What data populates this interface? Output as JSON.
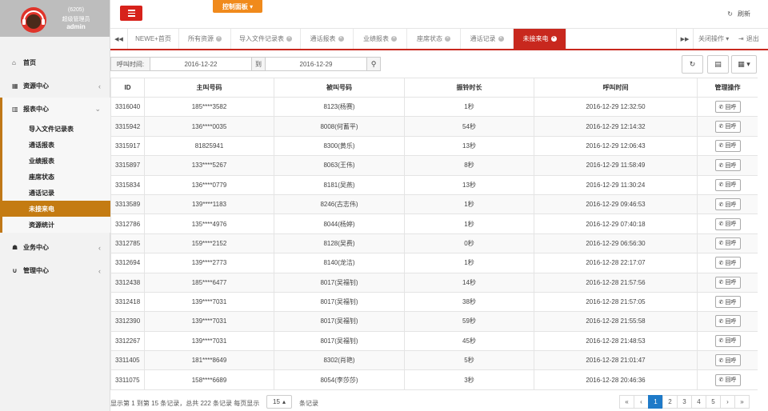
{
  "user": {
    "id": "(6205)",
    "role": "超级管理员",
    "name": "admin"
  },
  "sidebar": {
    "items": [
      {
        "label": "首页",
        "icon": "home-icon",
        "glyph": "⌂"
      },
      {
        "label": "资源中心",
        "icon": "table-icon",
        "glyph": "▦",
        "chev": "‹"
      },
      {
        "label": "报表中心",
        "icon": "bar-chart-icon",
        "glyph": "▥",
        "chev": "⌄"
      },
      {
        "label": "业务中心",
        "icon": "graduation-cap-icon",
        "glyph": "☗",
        "chev": "‹"
      },
      {
        "label": "管理中心",
        "icon": "magnet-icon",
        "glyph": "∪",
        "chev": "‹"
      }
    ],
    "sub": [
      "导入文件记录表",
      "通话报表",
      "业绩报表",
      "座席状态",
      "通话记录",
      "未接来电",
      "资源统计"
    ]
  },
  "topbar": {
    "control_panel": "控制面板 ▾",
    "refresh": "刷新",
    "refresh_icon": "↻"
  },
  "tabs": {
    "items": [
      "NEWE+首页",
      "所有资源",
      "导入文件记录表",
      "通话报表",
      "业绩报表",
      "座席状态",
      "通话记录",
      "未接来电"
    ],
    "close_actions": "关闭操作 ▾",
    "exit": "退出",
    "prev": "◀◀",
    "next": "▶▶",
    "exit_icon": "⇥"
  },
  "filter": {
    "label": "呼叫时间:",
    "start": "2016-12-22",
    "to": "到",
    "end": "2016-12-29",
    "search_icon": "⚲",
    "tools": [
      "↻",
      "▤",
      "▦ ▾"
    ]
  },
  "table": {
    "headers": [
      "ID",
      "主叫号码",
      "被叫号码",
      "振铃时长",
      "呼叫时间",
      "管理操作"
    ],
    "action_label": "回呼",
    "action_icon": "✆",
    "rows": [
      [
        "3316040",
        "185****3582",
        "8123(杨赛)",
        "1秒",
        "2016-12-29 12:32:50"
      ],
      [
        "3315942",
        "136****0035",
        "8008(何蓄平)",
        "54秒",
        "2016-12-29 12:14:32"
      ],
      [
        "3315917",
        "81825941",
        "8300(黄乐)",
        "13秒",
        "2016-12-29 12:06:43"
      ],
      [
        "3315897",
        "133****5267",
        "8063(王伟)",
        "8秒",
        "2016-12-29 11:58:49"
      ],
      [
        "3315834",
        "136****0779",
        "8181(吴燕)",
        "13秒",
        "2016-12-29 11:30:24"
      ],
      [
        "3313589",
        "139****1183",
        "8246(古志伟)",
        "1秒",
        "2016-12-29 09:46:53"
      ],
      [
        "3312786",
        "135****4976",
        "8044(杨婷)",
        "1秒",
        "2016-12-29 07:40:18"
      ],
      [
        "3312785",
        "159****2152",
        "8128(吴费)",
        "0秒",
        "2016-12-29 06:56:30"
      ],
      [
        "3312694",
        "139****2773",
        "8140(龙洁)",
        "1秒",
        "2016-12-28 22:17:07"
      ],
      [
        "3312438",
        "185****6477",
        "8017(吴福钊)",
        "14秒",
        "2016-12-28 21:57:56"
      ],
      [
        "3312418",
        "139****7031",
        "8017(吴福钊)",
        "38秒",
        "2016-12-28 21:57:05"
      ],
      [
        "3312390",
        "139****7031",
        "8017(吴福钊)",
        "59秒",
        "2016-12-28 21:55:58"
      ],
      [
        "3312267",
        "139****7031",
        "8017(吴福钊)",
        "45秒",
        "2016-12-28 21:48:53"
      ],
      [
        "3311405",
        "181****8649",
        "8302(肖艳)",
        "5秒",
        "2016-12-28 21:01:47"
      ],
      [
        "3311075",
        "158****6689",
        "8054(李莎莎)",
        "3秒",
        "2016-12-28 20:46:36"
      ]
    ]
  },
  "footer": {
    "info": "显示第 1 到第 15 条记录，总共 222 条记录 每页显示",
    "page_size": "15",
    "page_size_caret": "▴",
    "after": "条记录",
    "pages": [
      "«",
      "‹",
      "1",
      "2",
      "3",
      "4",
      "5",
      "›",
      "»"
    ]
  }
}
